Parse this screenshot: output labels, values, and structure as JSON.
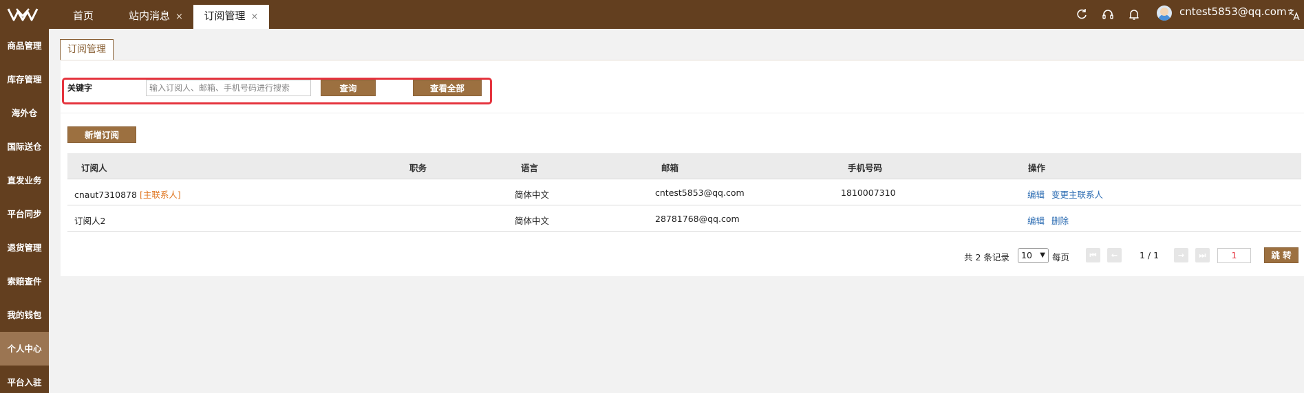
{
  "header": {
    "tabs": [
      {
        "label": "首页",
        "closable": false
      },
      {
        "label": "站内消息",
        "closable": true
      },
      {
        "label": "订阅管理",
        "closable": true,
        "active": true
      }
    ],
    "close_glyph": "×",
    "user_email": "cntest5853@qq.com",
    "icons": [
      "refresh-icon",
      "headset-icon",
      "bell-icon",
      "translate-icon"
    ]
  },
  "sidebar": {
    "items": [
      {
        "label": "商品管理"
      },
      {
        "label": "库存管理"
      },
      {
        "label": "海外仓"
      },
      {
        "label": "国际送仓"
      },
      {
        "label": "直发业务"
      },
      {
        "label": "平台同步"
      },
      {
        "label": "退货管理"
      },
      {
        "label": "索赔查件"
      },
      {
        "label": "我的钱包"
      },
      {
        "label": "个人中心",
        "active": true
      },
      {
        "label": "平台入驻"
      }
    ]
  },
  "page": {
    "subtab": "订阅管理",
    "search": {
      "label": "关键字",
      "placeholder": "输入订阅人、邮箱、手机号码进行搜索",
      "value": "",
      "query_button": "查询",
      "view_all_button": "查看全部"
    },
    "add_button": "新增订阅"
  },
  "table": {
    "columns": [
      "订阅人",
      "职务",
      "语言",
      "邮箱",
      "手机号码",
      "操作"
    ],
    "rows": [
      {
        "subscriber": "cnaut7310878",
        "tag": "[主联系人]",
        "position": "",
        "language": "简体中文",
        "email": "cntest5853@qq.com",
        "phone": "1810007310",
        "actions": [
          "编辑",
          "变更主联系人"
        ]
      },
      {
        "subscriber": "订阅人2",
        "tag": "",
        "position": "",
        "language": "简体中文",
        "email": "28781768@qq.com",
        "phone": "",
        "actions": [
          "编辑",
          "删除"
        ]
      }
    ]
  },
  "pagination": {
    "total_text": "共 2 条记录",
    "page_size": "10",
    "per_page_label": "每页",
    "page_info": "1 / 1",
    "page_input": "1",
    "jump_button": "跳 转"
  },
  "colors": {
    "brand_dark": "#633f1f",
    "brand_button": "#9c7040",
    "sidebar_active": "#9b7552",
    "highlight_border": "#e5343e",
    "link": "#2d6db3",
    "tag": "#e07722"
  }
}
